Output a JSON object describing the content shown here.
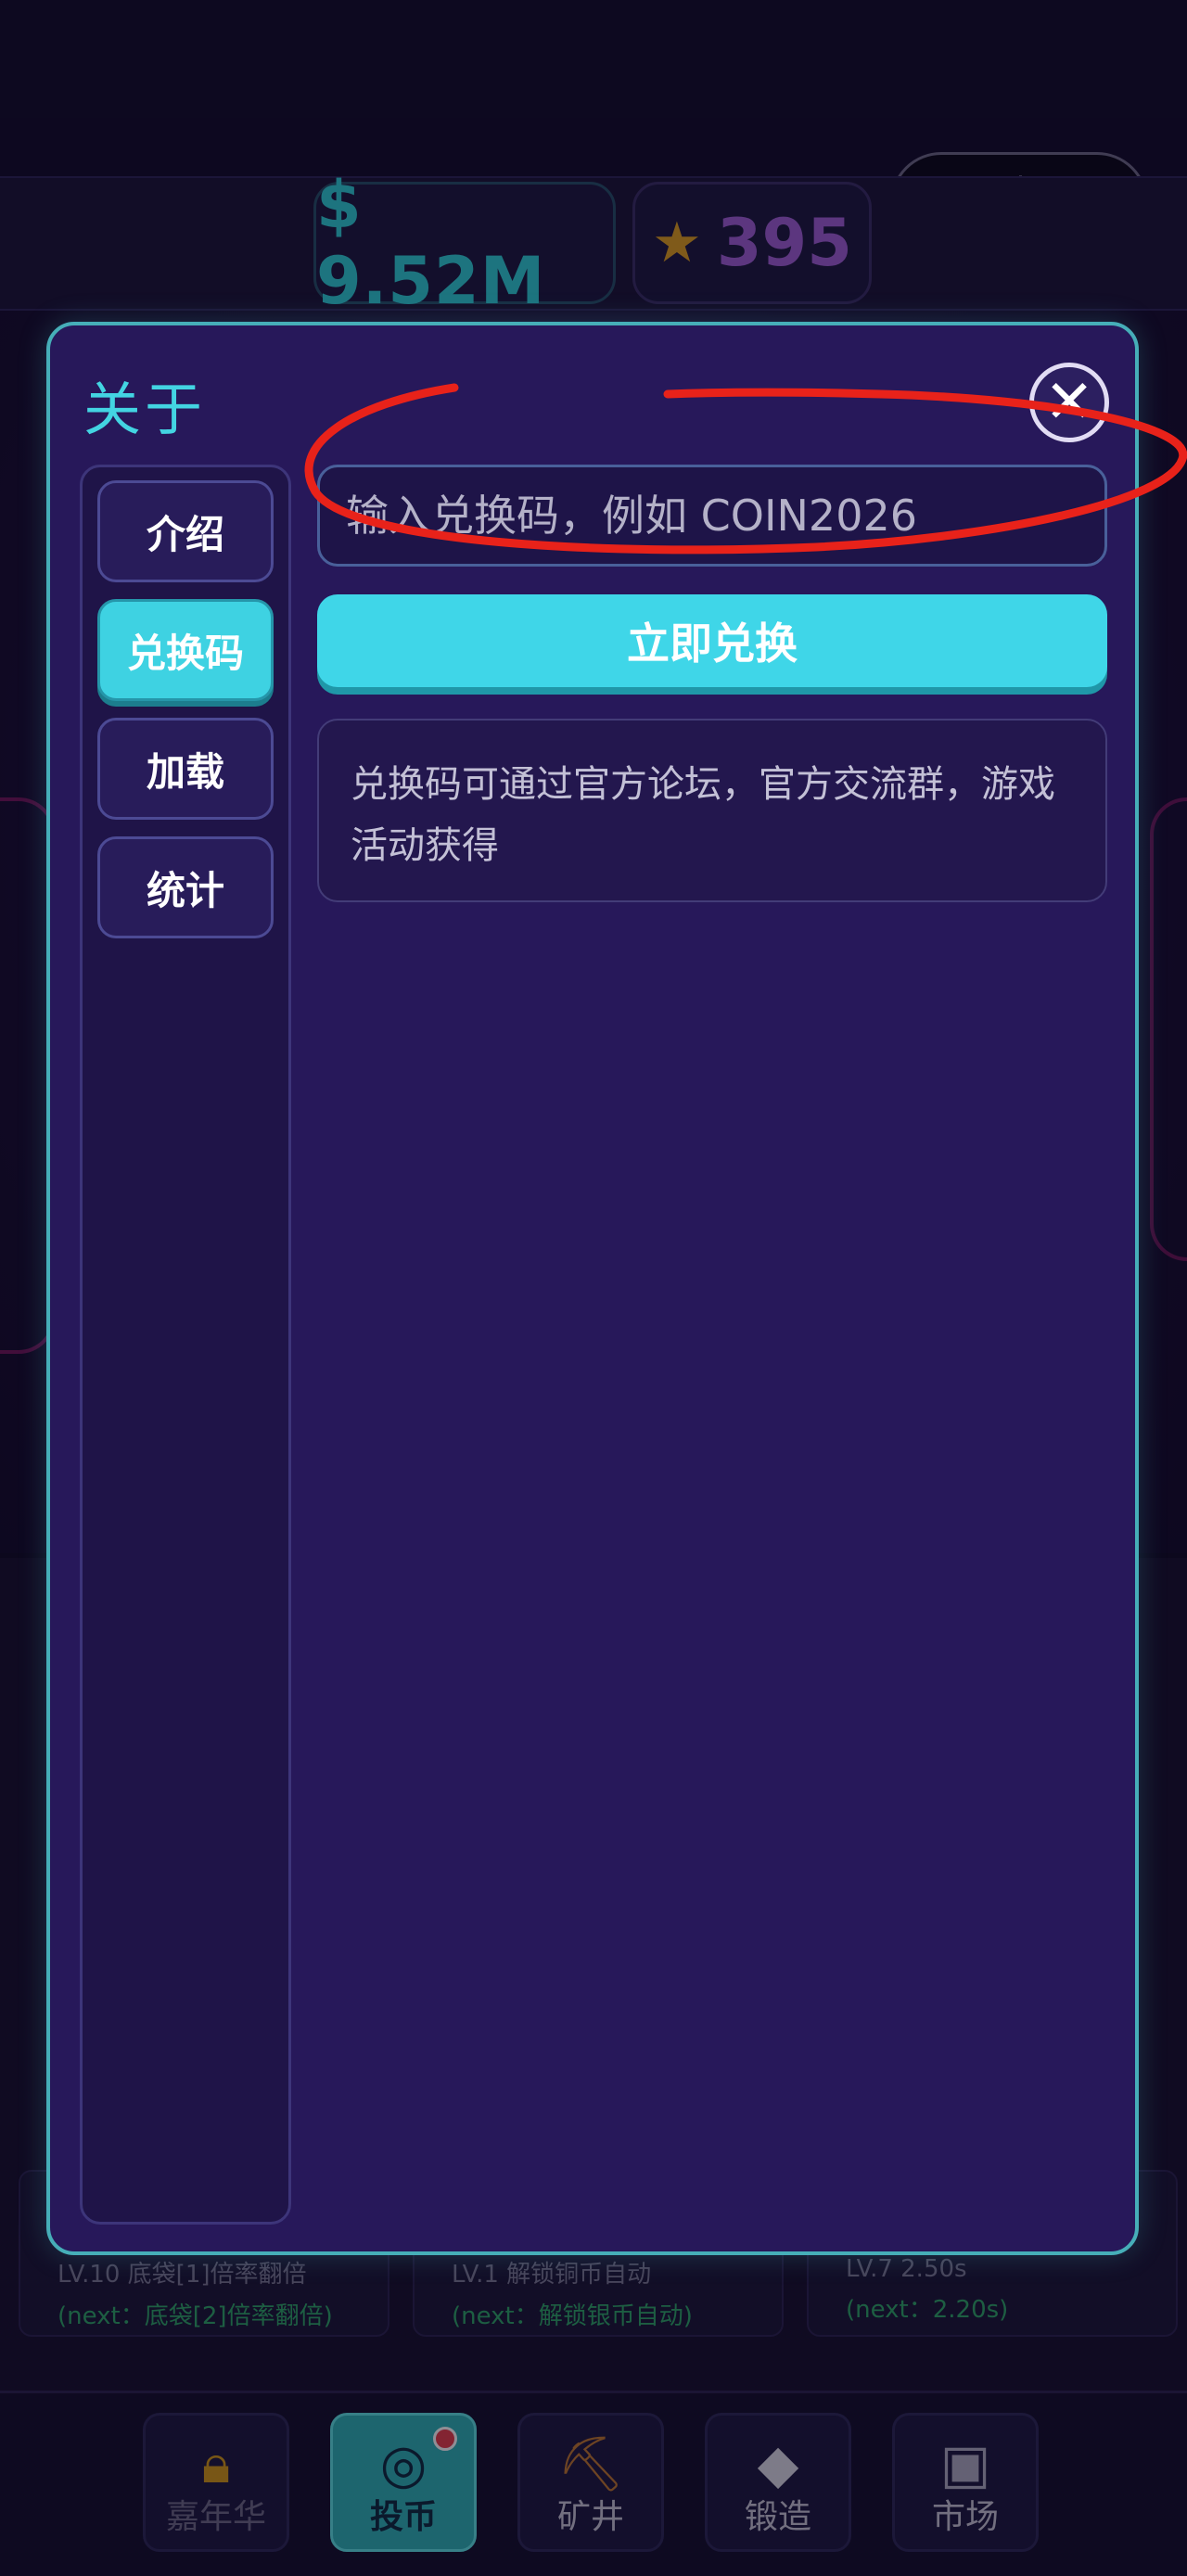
{
  "header": {
    "money": "$ 9.52M",
    "stars": "395",
    "star_icon": "star-icon"
  },
  "mini_program_capsule": {
    "more_icon": "more-dots-icon",
    "close_icon": "target-circle-icon"
  },
  "modal": {
    "title": "关于",
    "close_symbol": "✕",
    "tabs": [
      {
        "label": "介绍",
        "active": false
      },
      {
        "label": "兑换码",
        "active": true
      },
      {
        "label": "加载",
        "active": false
      },
      {
        "label": "统计",
        "active": false
      }
    ],
    "redeem": {
      "input_value": "",
      "input_placeholder": "输入兑换码，例如 COIN2026",
      "button_label": "立即兑换",
      "info_text": "兑换码可通过官方论坛，官方交流群，游戏活动获得"
    }
  },
  "upgrades": [
    {
      "level": "LV.10 底袋[1]倍率翻倍",
      "next": "(next：底袋[2]倍率翻倍)"
    },
    {
      "level": "LV.1 解锁铜币自动",
      "next": "(next：解锁银币自动)"
    },
    {
      "level": "LV.7 2.50s",
      "next": "(next：2.20s)"
    }
  ],
  "bottom_nav": {
    "items": [
      {
        "label": "嘉年华",
        "icon": "lock-icon",
        "locked": true
      },
      {
        "label": "投币",
        "icon": "coin-slot-icon",
        "active": true
      },
      {
        "label": "矿井",
        "icon": "pickaxe-icon"
      },
      {
        "label": "锻造",
        "icon": "diamond-icon"
      },
      {
        "label": "市场",
        "icon": "market-square-icon"
      }
    ]
  },
  "colors": {
    "accent": "#3fd6e8",
    "modal_bg": "#27185a",
    "modal_border": "#46aeb8",
    "annotation": "#e8221a"
  }
}
